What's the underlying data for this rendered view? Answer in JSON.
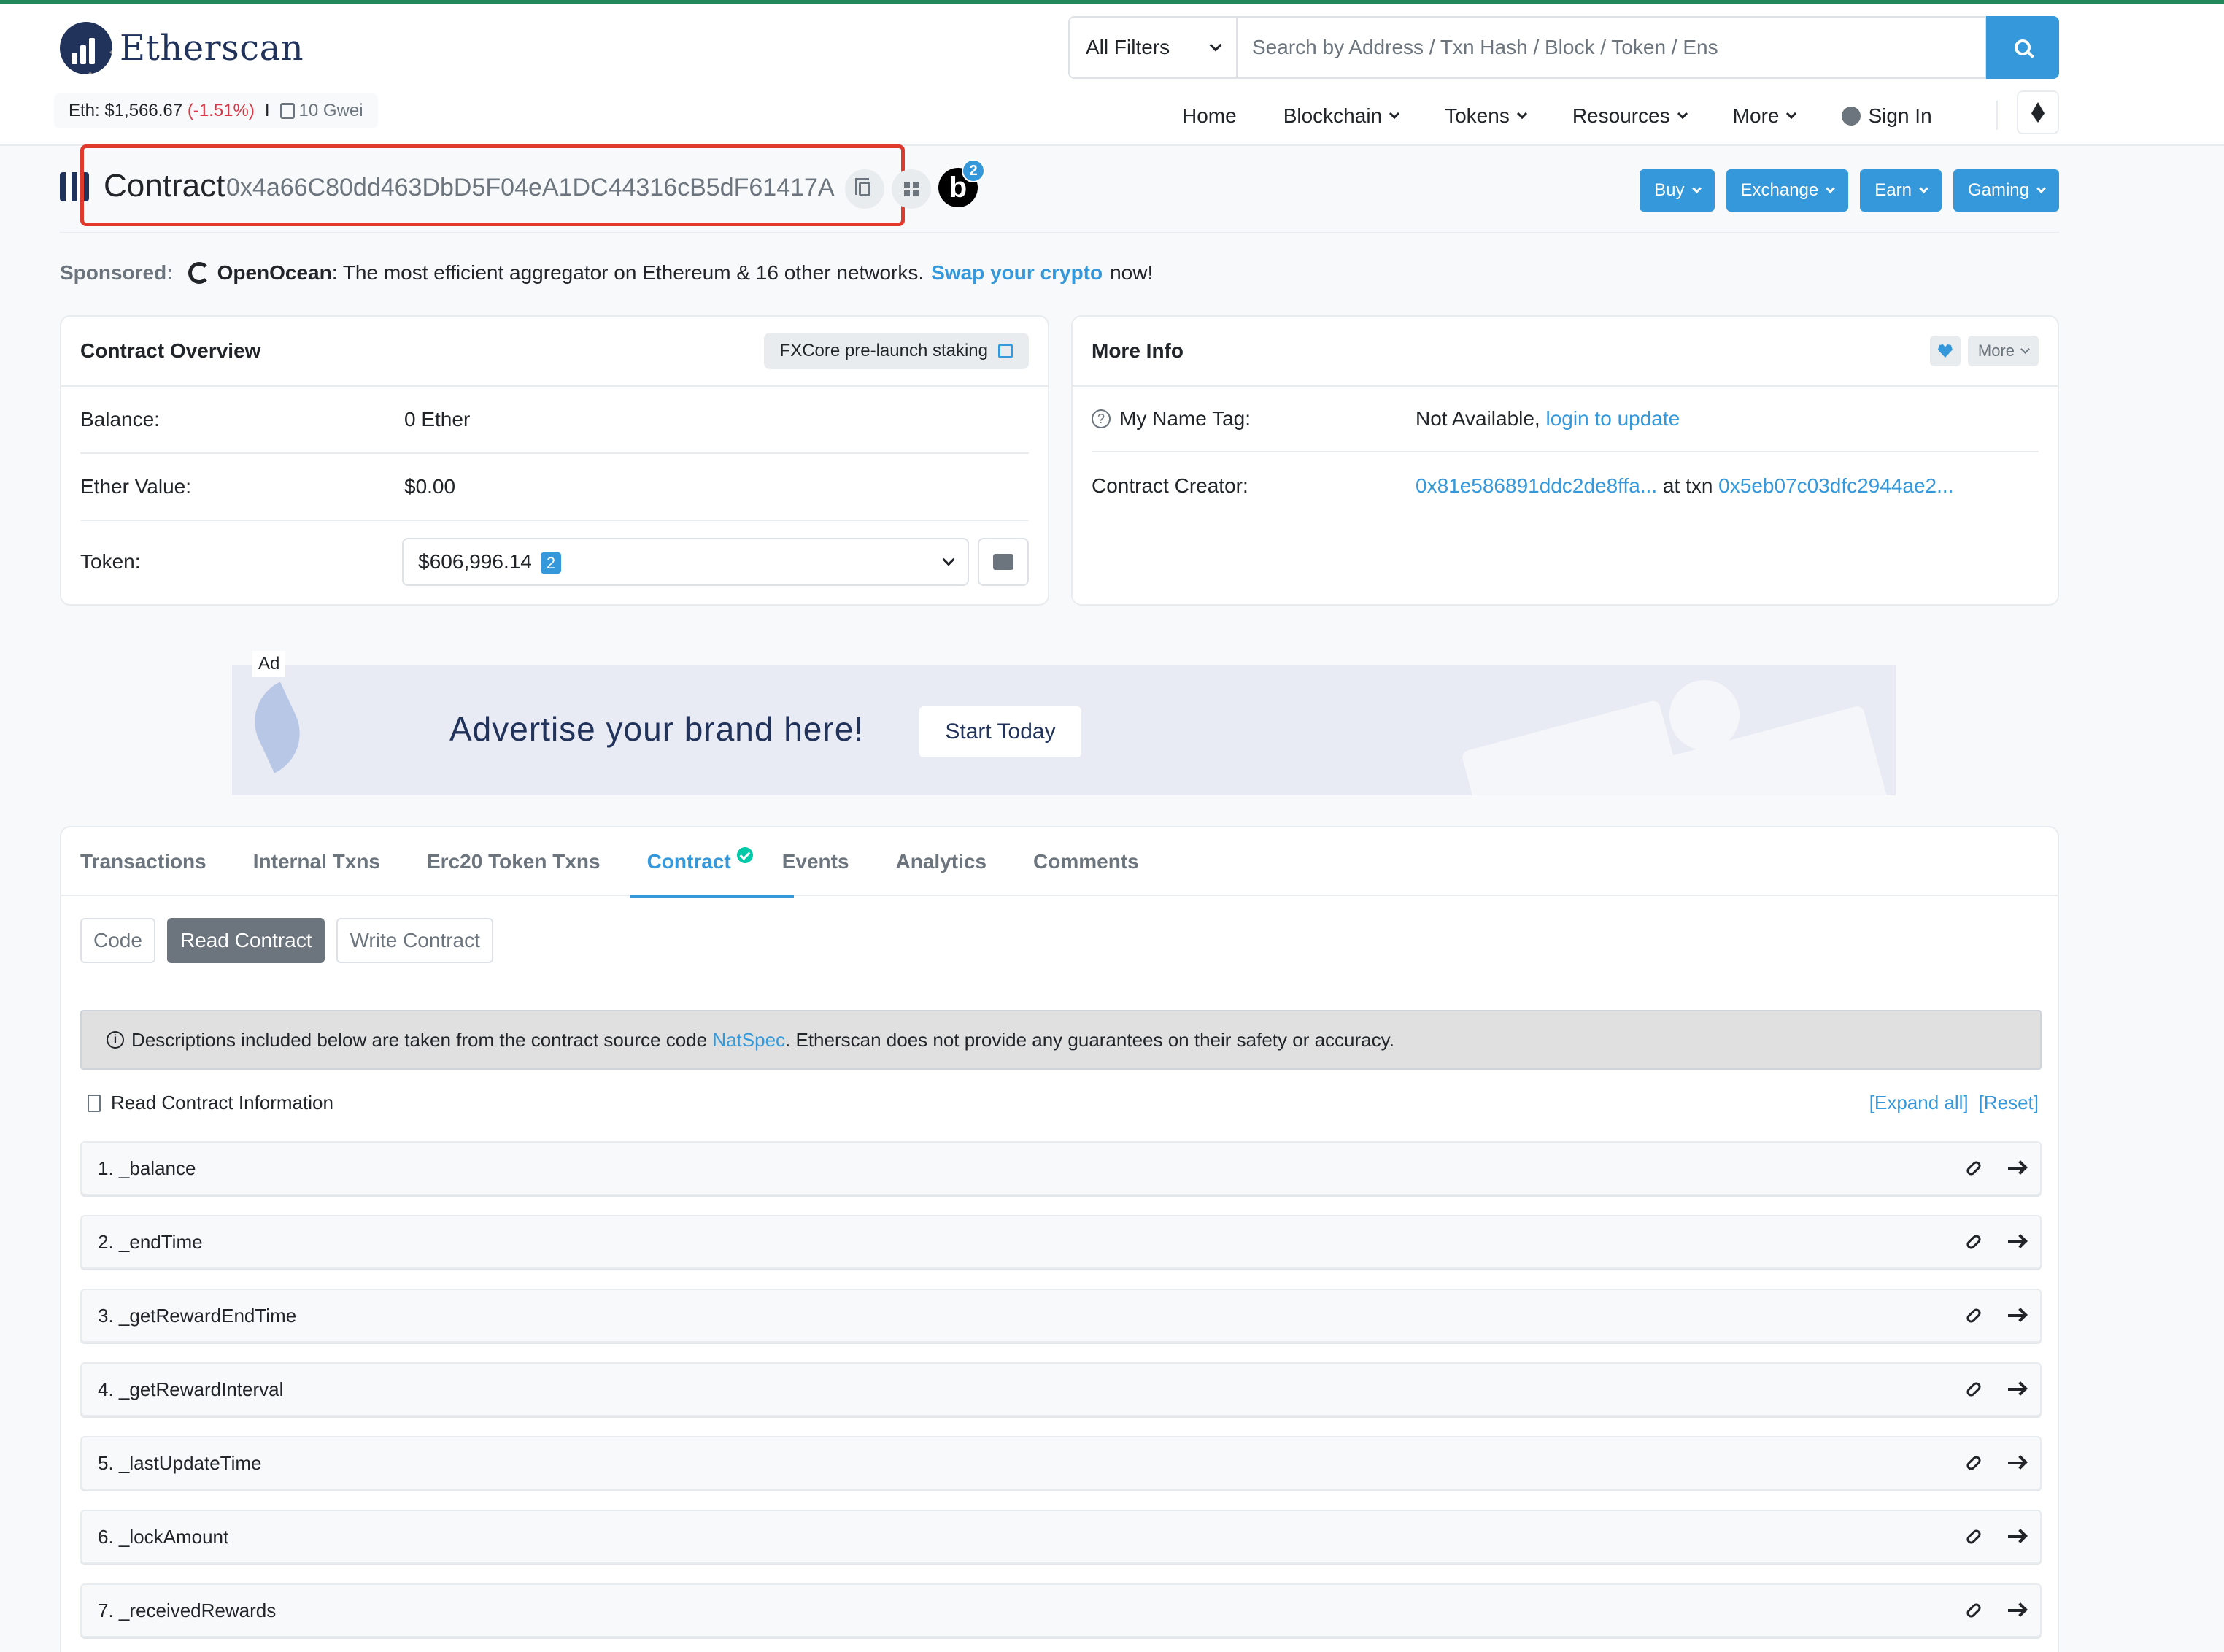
{
  "header": {
    "logo_text": "Etherscan",
    "eth_price": "Eth: $1,566.67",
    "eth_change": "(-1.51%)",
    "separator": "I",
    "gas": "10 Gwei",
    "filter_label": "All Filters",
    "search_placeholder": "Search by Address / Txn Hash / Block / Token / Ens",
    "nav": {
      "home": "Home",
      "blockchain": "Blockchain",
      "tokens": "Tokens",
      "resources": "Resources",
      "more": "More",
      "sign_in": "Sign In"
    }
  },
  "contract": {
    "label": "Contract",
    "address": "0x4a66C80dd463DbD5F04eA1DC44316cB5dF61417A",
    "badge_letter": "b",
    "badge_count": "2",
    "actions": {
      "buy": "Buy",
      "exchange": "Exchange",
      "earn": "Earn",
      "gaming": "Gaming"
    }
  },
  "sponsored": {
    "label": "Sponsored:",
    "brand": "OpenOcean",
    "text": ": The most efficient aggregator on Ethereum & 16 other networks.",
    "link": "Swap your crypto",
    "suffix": "now!"
  },
  "overview": {
    "title": "Contract Overview",
    "tag": "FXCore pre-launch staking",
    "balance_label": "Balance:",
    "balance_value": "0 Ether",
    "ether_value_label": "Ether Value:",
    "ether_value": "$0.00",
    "token_label": "Token:",
    "token_value": "$606,996.14",
    "token_count": "2"
  },
  "more_info": {
    "title": "More Info",
    "more_btn": "More",
    "name_tag_label": "My Name Tag:",
    "name_tag_value": "Not Available,",
    "name_tag_link": "login to update",
    "creator_label": "Contract Creator:",
    "creator_address": "0x81e586891ddc2de8ffa...",
    "at_txn": "at txn",
    "creator_txn": "0x5eb07c03dfc2944ae2..."
  },
  "ad": {
    "tag": "Ad",
    "text": "Advertise your brand here!",
    "button": "Start Today"
  },
  "tabs": {
    "transactions": "Transactions",
    "internal": "Internal Txns",
    "erc20": "Erc20 Token Txns",
    "contract": "Contract",
    "events": "Events",
    "analytics": "Analytics",
    "comments": "Comments"
  },
  "subtabs": {
    "code": "Code",
    "read": "Read Contract",
    "write": "Write Contract"
  },
  "notice": {
    "text_before": "Descriptions included below are taken from the contract source code",
    "link": "NatSpec",
    "text_after": ". Etherscan does not provide any guarantees on their safety or accuracy."
  },
  "read_info": {
    "title": "Read Contract Information",
    "expand_all": "[Expand all]",
    "reset": "[Reset]"
  },
  "functions": [
    "1. _balance",
    "2. _endTime",
    "3. _getRewardEndTime",
    "4. _getRewardInterval",
    "5. _lastUpdateTime",
    "6. _lockAmount",
    "7. _receivedRewards"
  ],
  "colors": {
    "accent": "#3498db",
    "highlight": "#e03a2f",
    "negative": "#dc3545",
    "verified": "#00c9a7",
    "brand_navy": "#21325b"
  }
}
